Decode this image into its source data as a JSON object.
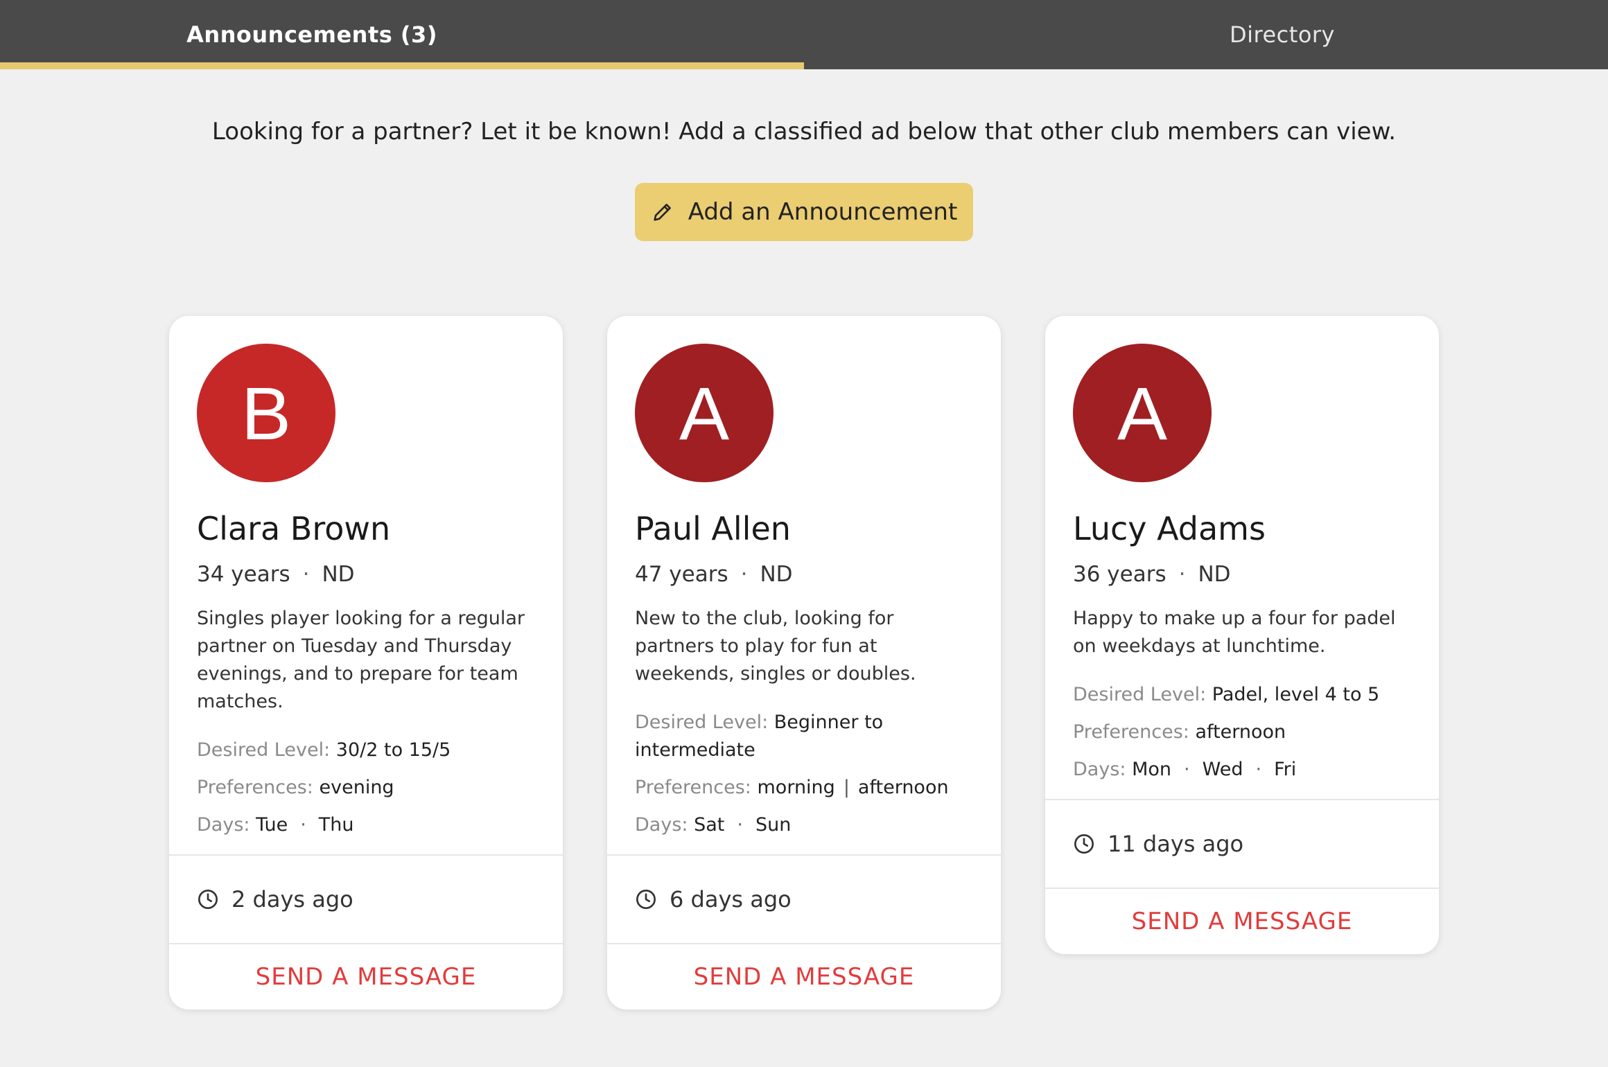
{
  "tabs": {
    "announcements": "Announcements (3)",
    "directory": "Directory"
  },
  "intro_text": "Looking for a partner? Let it be known! Add a classified ad below that other club members can view.",
  "add_button": {
    "label": "Add an Announcement",
    "icon": "pencil-icon"
  },
  "labels": {
    "desired_level": "Desired Level:",
    "preferences": "Preferences:",
    "days": "Days:",
    "send": "SEND A MESSAGE"
  },
  "colors": {
    "topbar": "#4a4a4a",
    "accent": "#ebcd72",
    "send_link": "#e23b3b"
  },
  "cards": [
    {
      "initial": "B",
      "avatar_color": "#c62828",
      "name": "Clara Brown",
      "age": "34 years",
      "rating": "ND",
      "description": "Singles player looking for a regular partner on Tuesday and Thursday evenings, and to prepare for team matches.",
      "desired_level": "30/2 to 15/5",
      "preferences": [
        "evening"
      ],
      "days": [
        "Tue",
        "Thu"
      ],
      "posted": "2 days ago"
    },
    {
      "initial": "A",
      "avatar_color": "#a01f22",
      "name": "Paul Allen",
      "age": "47 years",
      "rating": "ND",
      "description": "New to the club, looking for partners to play for fun at weekends, singles or doubles.",
      "desired_level": "Beginner to intermediate",
      "preferences": [
        "morning",
        "afternoon"
      ],
      "days": [
        "Sat",
        "Sun"
      ],
      "posted": "6 days ago"
    },
    {
      "initial": "A",
      "avatar_color": "#a01f22",
      "name": "Lucy Adams",
      "age": "36 years",
      "rating": "ND",
      "description": "Happy to make up a four for padel on weekdays at lunchtime.",
      "desired_level": "Padel, level 4 to 5",
      "preferences": [
        "afternoon"
      ],
      "days": [
        "Mon",
        "Wed",
        "Fri"
      ],
      "posted": "11 days ago"
    }
  ]
}
